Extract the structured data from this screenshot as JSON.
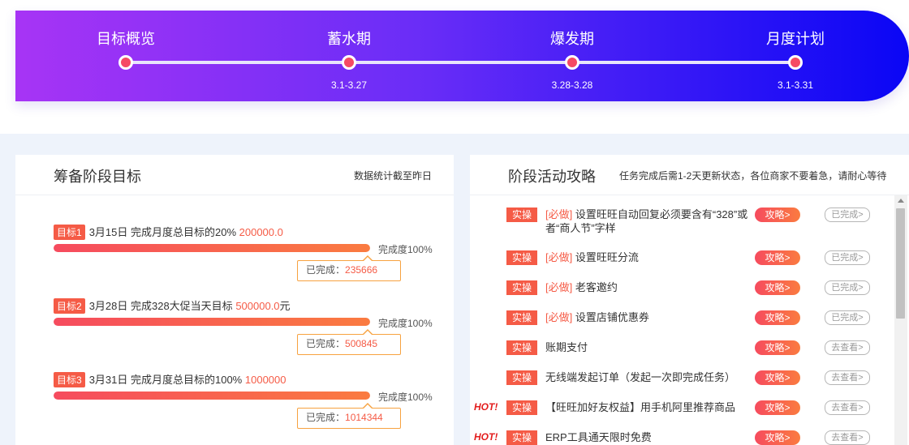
{
  "timeline": {
    "stages": [
      {
        "title": "目标概览",
        "date": ""
      },
      {
        "title": "蓄水期",
        "date": "3.1-3.27"
      },
      {
        "title": "爆发期",
        "date": "3.28-3.28"
      },
      {
        "title": "月度计划",
        "date": "3.1-3.31"
      }
    ],
    "colors": {
      "gradient_start": "#a734f5",
      "gradient_end": "#0a06f5",
      "dot": "#f54a64"
    }
  },
  "goals_panel": {
    "title": "筹备阶段目标",
    "note": "数据统计截至昨日",
    "goals": [
      {
        "tag": "目标1",
        "text": "3月15日 完成月度总目标的20%",
        "amount": "200000.0",
        "suffix": "",
        "progress_label": "完成度100%",
        "progress": 1.0,
        "done_label": "已完成：",
        "done_value": "235666"
      },
      {
        "tag": "目标2",
        "text": "3月28日 完成328大促当天目标",
        "amount": "500000.0",
        "suffix": "元",
        "progress_label": "完成度100%",
        "progress": 1.0,
        "done_label": "已完成：",
        "done_value": "500845"
      },
      {
        "tag": "目标3",
        "text": "3月31日 完成月度总目标的100%",
        "amount": "1000000",
        "suffix": "",
        "progress_label": "完成度100%",
        "progress": 1.0,
        "done_label": "已完成：",
        "done_value": "1014344"
      }
    ]
  },
  "tasks_panel": {
    "title": "阶段活动攻略",
    "note": "任务完成后需1-2天更新状态，各位商家不要着急，请耐心等待",
    "tasks": [
      {
        "hot": "",
        "tag": "实操",
        "must": "[必做]",
        "text": "设置旺旺自动回复必须要含有“328”或者“商人节”字样",
        "guide": "攻略>",
        "status": "已完成>"
      },
      {
        "hot": "",
        "tag": "实操",
        "must": "[必做]",
        "text": "设置旺旺分流",
        "guide": "攻略>",
        "status": "已完成>"
      },
      {
        "hot": "",
        "tag": "实操",
        "must": "[必做]",
        "text": "老客邀约",
        "guide": "攻略>",
        "status": "已完成>"
      },
      {
        "hot": "",
        "tag": "实操",
        "must": "[必做]",
        "text": "设置店铺优惠券",
        "guide": "攻略>",
        "status": "已完成>"
      },
      {
        "hot": "",
        "tag": "实操",
        "must": "",
        "text": "账期支付",
        "guide": "攻略>",
        "status": "去查看>"
      },
      {
        "hot": "",
        "tag": "实操",
        "must": "",
        "text": "无线端发起订单（发起一次即完成任务）",
        "guide": "攻略>",
        "status": "去查看>"
      },
      {
        "hot": "HOT!",
        "tag": "实操",
        "must": "",
        "text": "【旺旺加好友权益】用手机阿里推荐商品",
        "guide": "攻略>",
        "status": "去查看>"
      },
      {
        "hot": "HOT!",
        "tag": "实操",
        "must": "",
        "text": "ERP工具通天限时免费",
        "guide": "攻略>",
        "status": "去查看>"
      }
    ]
  }
}
